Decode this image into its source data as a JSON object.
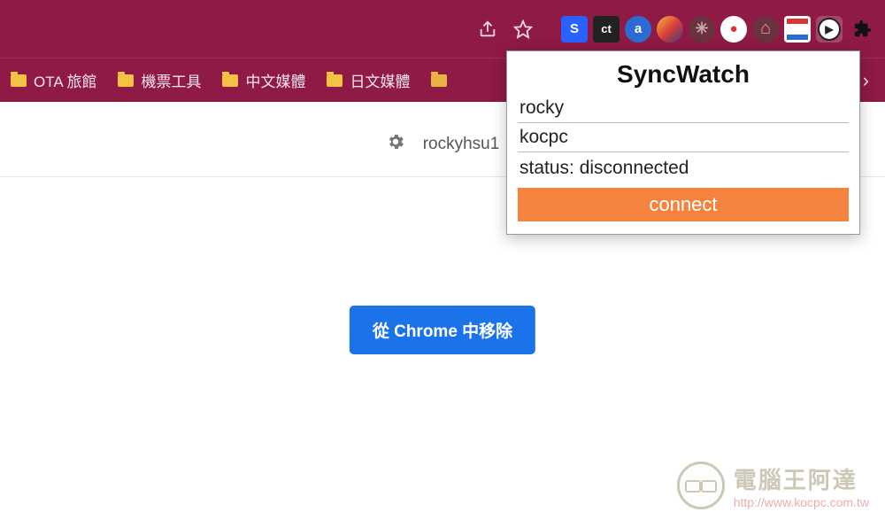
{
  "toolbar": {
    "share_icon": "share-icon",
    "star_icon": "star-icon",
    "extensions": [
      {
        "name": "ext-s",
        "label": "S",
        "bg": "#2962ff",
        "round": false
      },
      {
        "name": "ext-ct",
        "label": "ct",
        "bg": "#222",
        "round": false
      },
      {
        "name": "ext-a",
        "label": "a",
        "bg": "#2b6cd4",
        "round": true
      },
      {
        "name": "ext-swirl",
        "label": "",
        "bg": "linear-gradient(135deg,#f5b841,#d9403a,#3a3a7a)",
        "round": true
      },
      {
        "name": "ext-spider",
        "label": "✱",
        "bg": "#6a323f",
        "round": true
      },
      {
        "name": "ext-rec",
        "label": "●",
        "bg": "#fff",
        "round": true,
        "color": "#d33"
      },
      {
        "name": "ext-mountain",
        "label": "◠",
        "bg": "#6a323f",
        "round": true
      },
      {
        "name": "ext-cards",
        "label": "▭",
        "bg": "#fff",
        "round": false,
        "stripe": true
      },
      {
        "name": "ext-syncwatch",
        "label": "▷",
        "bg": "#fff",
        "round": true,
        "color": "#222",
        "active": true
      },
      {
        "name": "ext-puzzle",
        "label": "✦",
        "bg": "transparent",
        "round": false,
        "color": "#222"
      }
    ]
  },
  "bookmarks": [
    {
      "label": "OTA 旅館"
    },
    {
      "label": "機票工具"
    },
    {
      "label": "中文媒體"
    },
    {
      "label": "日文媒體"
    }
  ],
  "bookmarks_more": "›",
  "page": {
    "username": "rockyhsu1",
    "remove_button": "從 Chrome 中移除"
  },
  "popup": {
    "title": "SyncWatch",
    "field_name_value": "rocky",
    "field_room_value": "kocpc",
    "status_label": "status: disconnected",
    "connect_label": "connect"
  },
  "watermark": {
    "line1": "電腦王阿達",
    "line2": "http://www.kocpc.com.tw"
  }
}
